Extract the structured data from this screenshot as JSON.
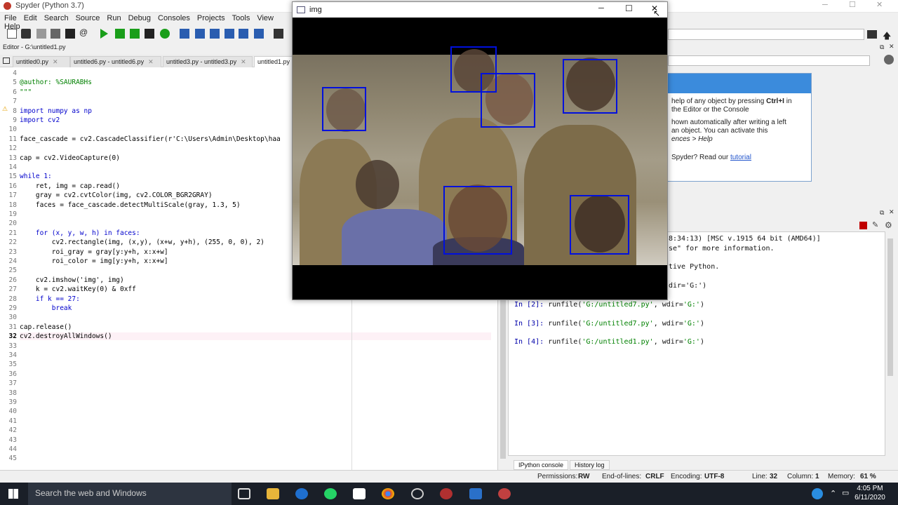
{
  "app": {
    "title": "Spyder (Python 3.7)"
  },
  "menu": [
    "File",
    "Edit",
    "Search",
    "Source",
    "Run",
    "Debug",
    "Consoles",
    "Projects",
    "Tools",
    "View",
    "Help"
  ],
  "editor": {
    "path": "Editor - G:\\untitled1.py",
    "tabs": [
      "untitled0.py",
      "untitled6.py - untitled6.py",
      "untitled3.py - untitled3.py",
      "untitled1.py"
    ],
    "lines": [
      {
        "n": "4",
        "t": ""
      },
      {
        "n": "5",
        "t": "@author: %SAURABHs"
      },
      {
        "n": "6",
        "t": "\"\"\""
      },
      {
        "n": "7",
        "t": ""
      },
      {
        "n": "8",
        "t": "import numpy as np"
      },
      {
        "n": "9",
        "t": "import cv2"
      },
      {
        "n": "10",
        "t": ""
      },
      {
        "n": "11",
        "t": "face_cascade = cv2.CascadeClassifier(r'C:\\Users\\Admin\\Desktop\\haa"
      },
      {
        "n": "12",
        "t": ""
      },
      {
        "n": "13",
        "t": "cap = cv2.VideoCapture(0)"
      },
      {
        "n": "14",
        "t": ""
      },
      {
        "n": "15",
        "t": "while 1:"
      },
      {
        "n": "16",
        "t": "    ret, img = cap.read()"
      },
      {
        "n": "17",
        "t": "    gray = cv2.cvtColor(img, cv2.COLOR_BGR2GRAY)"
      },
      {
        "n": "18",
        "t": "    faces = face_cascade.detectMultiScale(gray, 1.3, 5)"
      },
      {
        "n": "19",
        "t": ""
      },
      {
        "n": "20",
        "t": ""
      },
      {
        "n": "21",
        "t": "    for (x, y, w, h) in faces:"
      },
      {
        "n": "22",
        "t": "        cv2.rectangle(img, (x,y), (x+w, y+h), (255, 0, 0), 2)"
      },
      {
        "n": "23",
        "t": "        roi_gray = gray[y:y+h, x:x+w]"
      },
      {
        "n": "24",
        "t": "        roi_color = img[y:y+h, x:x+w]"
      },
      {
        "n": "25",
        "t": ""
      },
      {
        "n": "26",
        "t": "    cv2.imshow('img', img)"
      },
      {
        "n": "27",
        "t": "    k = cv2.waitKey(0) & 0xff"
      },
      {
        "n": "28",
        "t": "    if k == 27:"
      },
      {
        "n": "29",
        "t": "        break"
      },
      {
        "n": "30",
        "t": ""
      },
      {
        "n": "31",
        "t": "cap.release()"
      },
      {
        "n": "32",
        "t": "cv2.destroyAllWindows()"
      },
      {
        "n": "33",
        "t": ""
      },
      {
        "n": "34",
        "t": ""
      },
      {
        "n": "35",
        "t": ""
      },
      {
        "n": "36",
        "t": ""
      },
      {
        "n": "37",
        "t": ""
      },
      {
        "n": "38",
        "t": ""
      },
      {
        "n": "39",
        "t": ""
      },
      {
        "n": "40",
        "t": ""
      },
      {
        "n": "41",
        "t": ""
      },
      {
        "n": "42",
        "t": ""
      },
      {
        "n": "43",
        "t": ""
      },
      {
        "n": "44",
        "t": ""
      },
      {
        "n": "45",
        "t": ""
      }
    ]
  },
  "help": {
    "line1a": "help of any object by pressing ",
    "line1b": "Ctrl+I",
    "line1c": " in",
    "line2": "the Editor or the Console",
    "line3": "hown automatically after writing a left",
    "line4": "an object. You can activate this",
    "line5": "ences > Help",
    "line6a": "Spyder? Read our ",
    "line6b": "tutorial"
  },
  "console": {
    "lines": [
      "8:34:13) [MSC v.1915 64 bit (AMD64)]",
      "se\" for more information.",
      "",
      "tive Python.",
      "",
      "dir='G:')"
    ],
    "inputs": [
      {
        "prompt": "In [2]:",
        "cmd": " runfile(",
        "arg": "'G:/untitled7.py'",
        "rest": ", wdir=",
        "wdir": "'G:'",
        "end": ")"
      },
      {
        "prompt": "In [3]:",
        "cmd": " runfile(",
        "arg": "'G:/untitled7.py'",
        "rest": ", wdir=",
        "wdir": "'G:'",
        "end": ")"
      },
      {
        "prompt": "In [4]:",
        "cmd": " runfile(",
        "arg": "'G:/untitled1.py'",
        "rest": ", wdir=",
        "wdir": "'G:'",
        "end": ")"
      }
    ],
    "tabs": [
      "IPython console",
      "History log"
    ]
  },
  "status": {
    "permissions_label": "Permissions:",
    "permissions": "RW",
    "eol_label": "End-of-lines:",
    "eol": "CRLF",
    "encoding_label": "Encoding:",
    "encoding": "UTF-8",
    "line_label": "Line:",
    "line": "32",
    "column_label": "Column:",
    "column": "1",
    "memory_label": "Memory:",
    "memory": "61 %"
  },
  "image_window": {
    "title": "img",
    "face_box_color": "#0010dd"
  },
  "taskbar": {
    "search_placeholder": "Search the web and Windows",
    "time": "4:05 PM",
    "date": "6/11/2020"
  }
}
